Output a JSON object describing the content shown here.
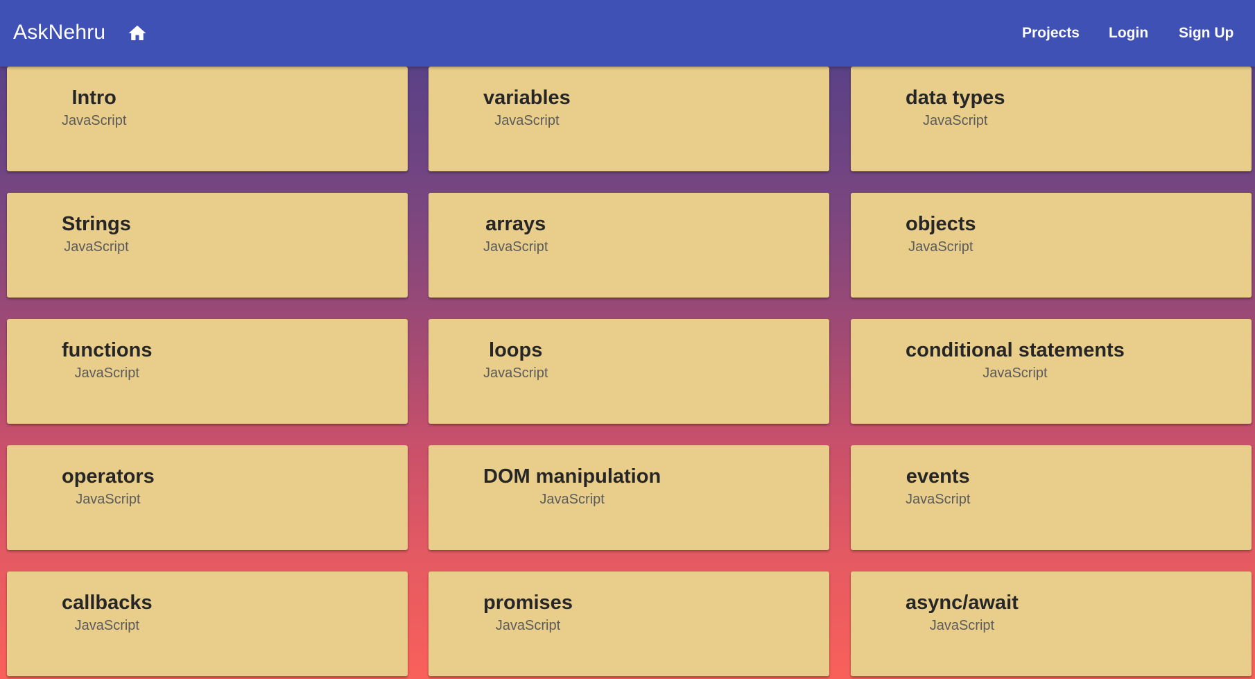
{
  "nav": {
    "brand": "AskNehru",
    "home_icon": "home-icon",
    "links": [
      "Projects",
      "Login",
      "Sign Up"
    ]
  },
  "colors": {
    "navbar": "#3f51b5",
    "card": "#e9ce8b",
    "gradient_top": "#4d3c8c",
    "gradient_bottom": "#f9605a"
  },
  "cards": [
    {
      "title": "Intro",
      "subtitle": "JavaScript"
    },
    {
      "title": "variables",
      "subtitle": "JavaScript"
    },
    {
      "title": "data types",
      "subtitle": "JavaScript"
    },
    {
      "title": "Strings",
      "subtitle": "JavaScript"
    },
    {
      "title": "arrays",
      "subtitle": "JavaScript"
    },
    {
      "title": "objects",
      "subtitle": "JavaScript"
    },
    {
      "title": "functions",
      "subtitle": "JavaScript"
    },
    {
      "title": "loops",
      "subtitle": "JavaScript"
    },
    {
      "title": "conditional statements",
      "subtitle": "JavaScript"
    },
    {
      "title": "operators",
      "subtitle": "JavaScript"
    },
    {
      "title": "DOM manipulation",
      "subtitle": "JavaScript"
    },
    {
      "title": "events",
      "subtitle": "JavaScript"
    },
    {
      "title": "callbacks",
      "subtitle": "JavaScript"
    },
    {
      "title": "promises",
      "subtitle": "JavaScript"
    },
    {
      "title": "async/await",
      "subtitle": "JavaScript"
    }
  ]
}
